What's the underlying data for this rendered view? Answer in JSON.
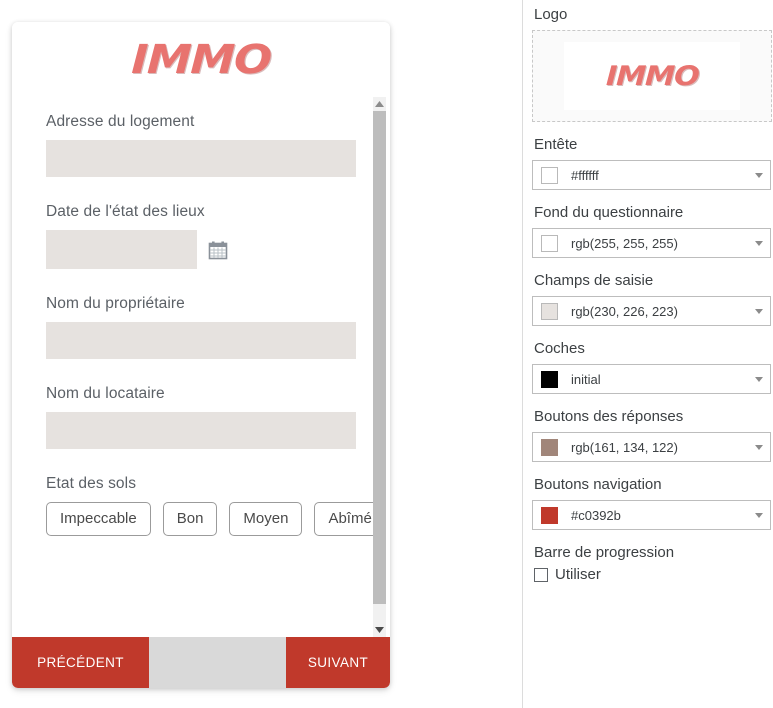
{
  "preview": {
    "logo_text": "IMMO",
    "fields": [
      {
        "label": "Adresse du logement",
        "type": "text",
        "value": ""
      },
      {
        "label": "Date de l'état des lieux",
        "type": "date",
        "value": ""
      },
      {
        "label": "Nom du propriétaire",
        "type": "text",
        "value": ""
      },
      {
        "label": "Nom du locataire",
        "type": "text",
        "value": ""
      }
    ],
    "choice_question": {
      "label": "Etat des sols",
      "options": [
        "Impeccable",
        "Bon",
        "Moyen",
        "Abîmé"
      ]
    },
    "nav": {
      "previous_label": "PRÉCÉDENT",
      "next_label": "SUIVANT"
    }
  },
  "settings": {
    "logo": {
      "label": "Logo",
      "logo_text": "IMMO"
    },
    "color_settings": [
      {
        "label": "Entête",
        "value": "#ffffff",
        "swatch": "#ffffff"
      },
      {
        "label": "Fond du questionnaire",
        "value": "rgb(255, 255, 255)",
        "swatch": "#ffffff"
      },
      {
        "label": "Champs de saisie",
        "value": "rgb(230, 226, 223)",
        "swatch": "#e6e2df"
      },
      {
        "label": "Coches",
        "value": "initial",
        "swatch": "#000000"
      },
      {
        "label": "Boutons des réponses",
        "value": "rgb(161, 134, 122)",
        "swatch": "#a1867a"
      },
      {
        "label": "Boutons navigation",
        "value": "#c0392b",
        "swatch": "#c0392b"
      }
    ],
    "progress": {
      "label": "Barre de progression",
      "checkbox_label": "Utiliser",
      "checked": false
    }
  },
  "colors": {
    "accent_red": "#c0392b",
    "logo_red": "#e8736f",
    "input_bg": "#e6e2df",
    "navbar_bg": "#d9d9d9"
  },
  "icons": {
    "calendar": "calendar-icon",
    "scroll_up": "scroll-up-arrow-icon",
    "scroll_down": "scroll-down-arrow-icon",
    "caret": "chevron-down-icon"
  }
}
